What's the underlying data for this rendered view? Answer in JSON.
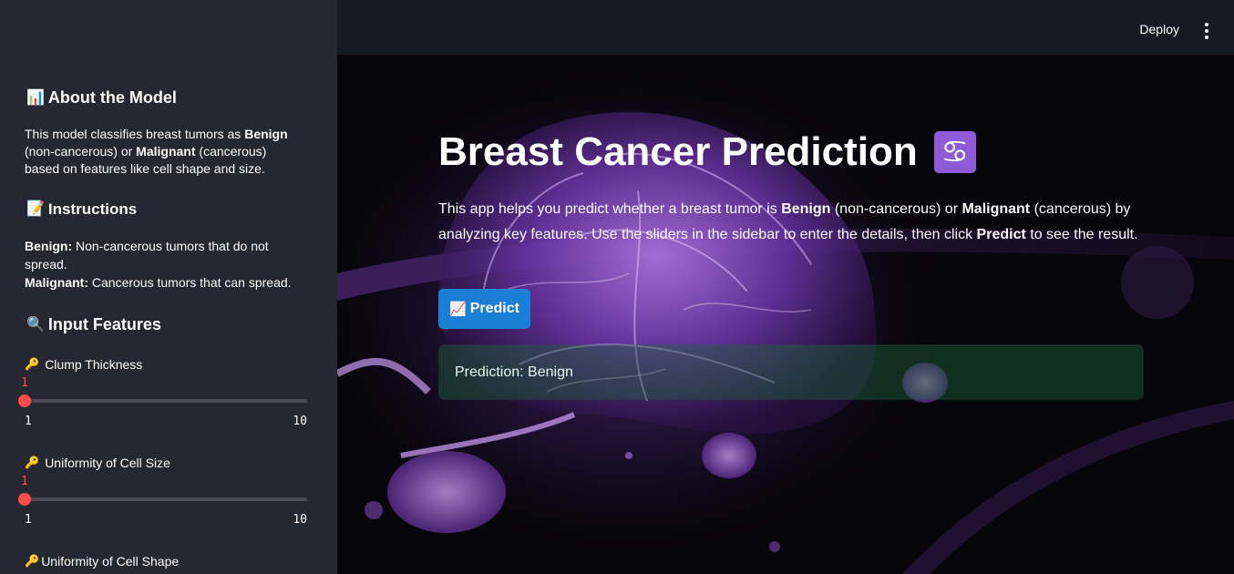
{
  "header": {
    "deploy_label": "Deploy",
    "menu_icon": "more-vertical-icon"
  },
  "sidebar": {
    "about": {
      "emoji": "📊",
      "title": "About the Model",
      "text_parts": [
        "This model classifies breast tumors as ",
        "Benign",
        " (non-cancerous) or ",
        "Malignant",
        " (cancerous) based on features like cell shape and size."
      ]
    },
    "instructions": {
      "emoji": "📝",
      "title": "Instructions",
      "benign_label": "Benign:",
      "benign_text": " Non-cancerous tumors that do not spread.",
      "malignant_label": "Malignant:",
      "malignant_text": " Cancerous tumors that can spread."
    },
    "input_features": {
      "emoji": "🔍",
      "title": "Input Features"
    },
    "sliders": [
      {
        "label": "Clump Thickness",
        "icon": "key-icon",
        "value": "1",
        "min": "1",
        "max": "10"
      },
      {
        "label": "Uniformity of Cell Size",
        "icon": "key-icon",
        "value": "1",
        "min": "1",
        "max": "10"
      },
      {
        "label": "Uniformity of Cell Shape",
        "icon": "key-icon"
      }
    ]
  },
  "main": {
    "title": "Breast Cancer Prediction",
    "title_emoji": "♋",
    "desc_parts": [
      "This app helps you predict whether a breast tumor is ",
      "Benign",
      " (non-cancerous) or ",
      "Malignant",
      " (cancerous) by analyzing key features. Use the sliders in the sidebar to enter the details, then click ",
      "Predict",
      " to see the result."
    ],
    "predict_emoji": "📈",
    "predict_label": "Predict",
    "result_text": "Prediction: Benign"
  },
  "colors": {
    "sidebar_bg": "#262730",
    "accent_slider": "#ff4b4b",
    "button_blue": "#1c7fd6",
    "success_bg": "#1f613c",
    "badge_purple": "#8e5ad8"
  }
}
